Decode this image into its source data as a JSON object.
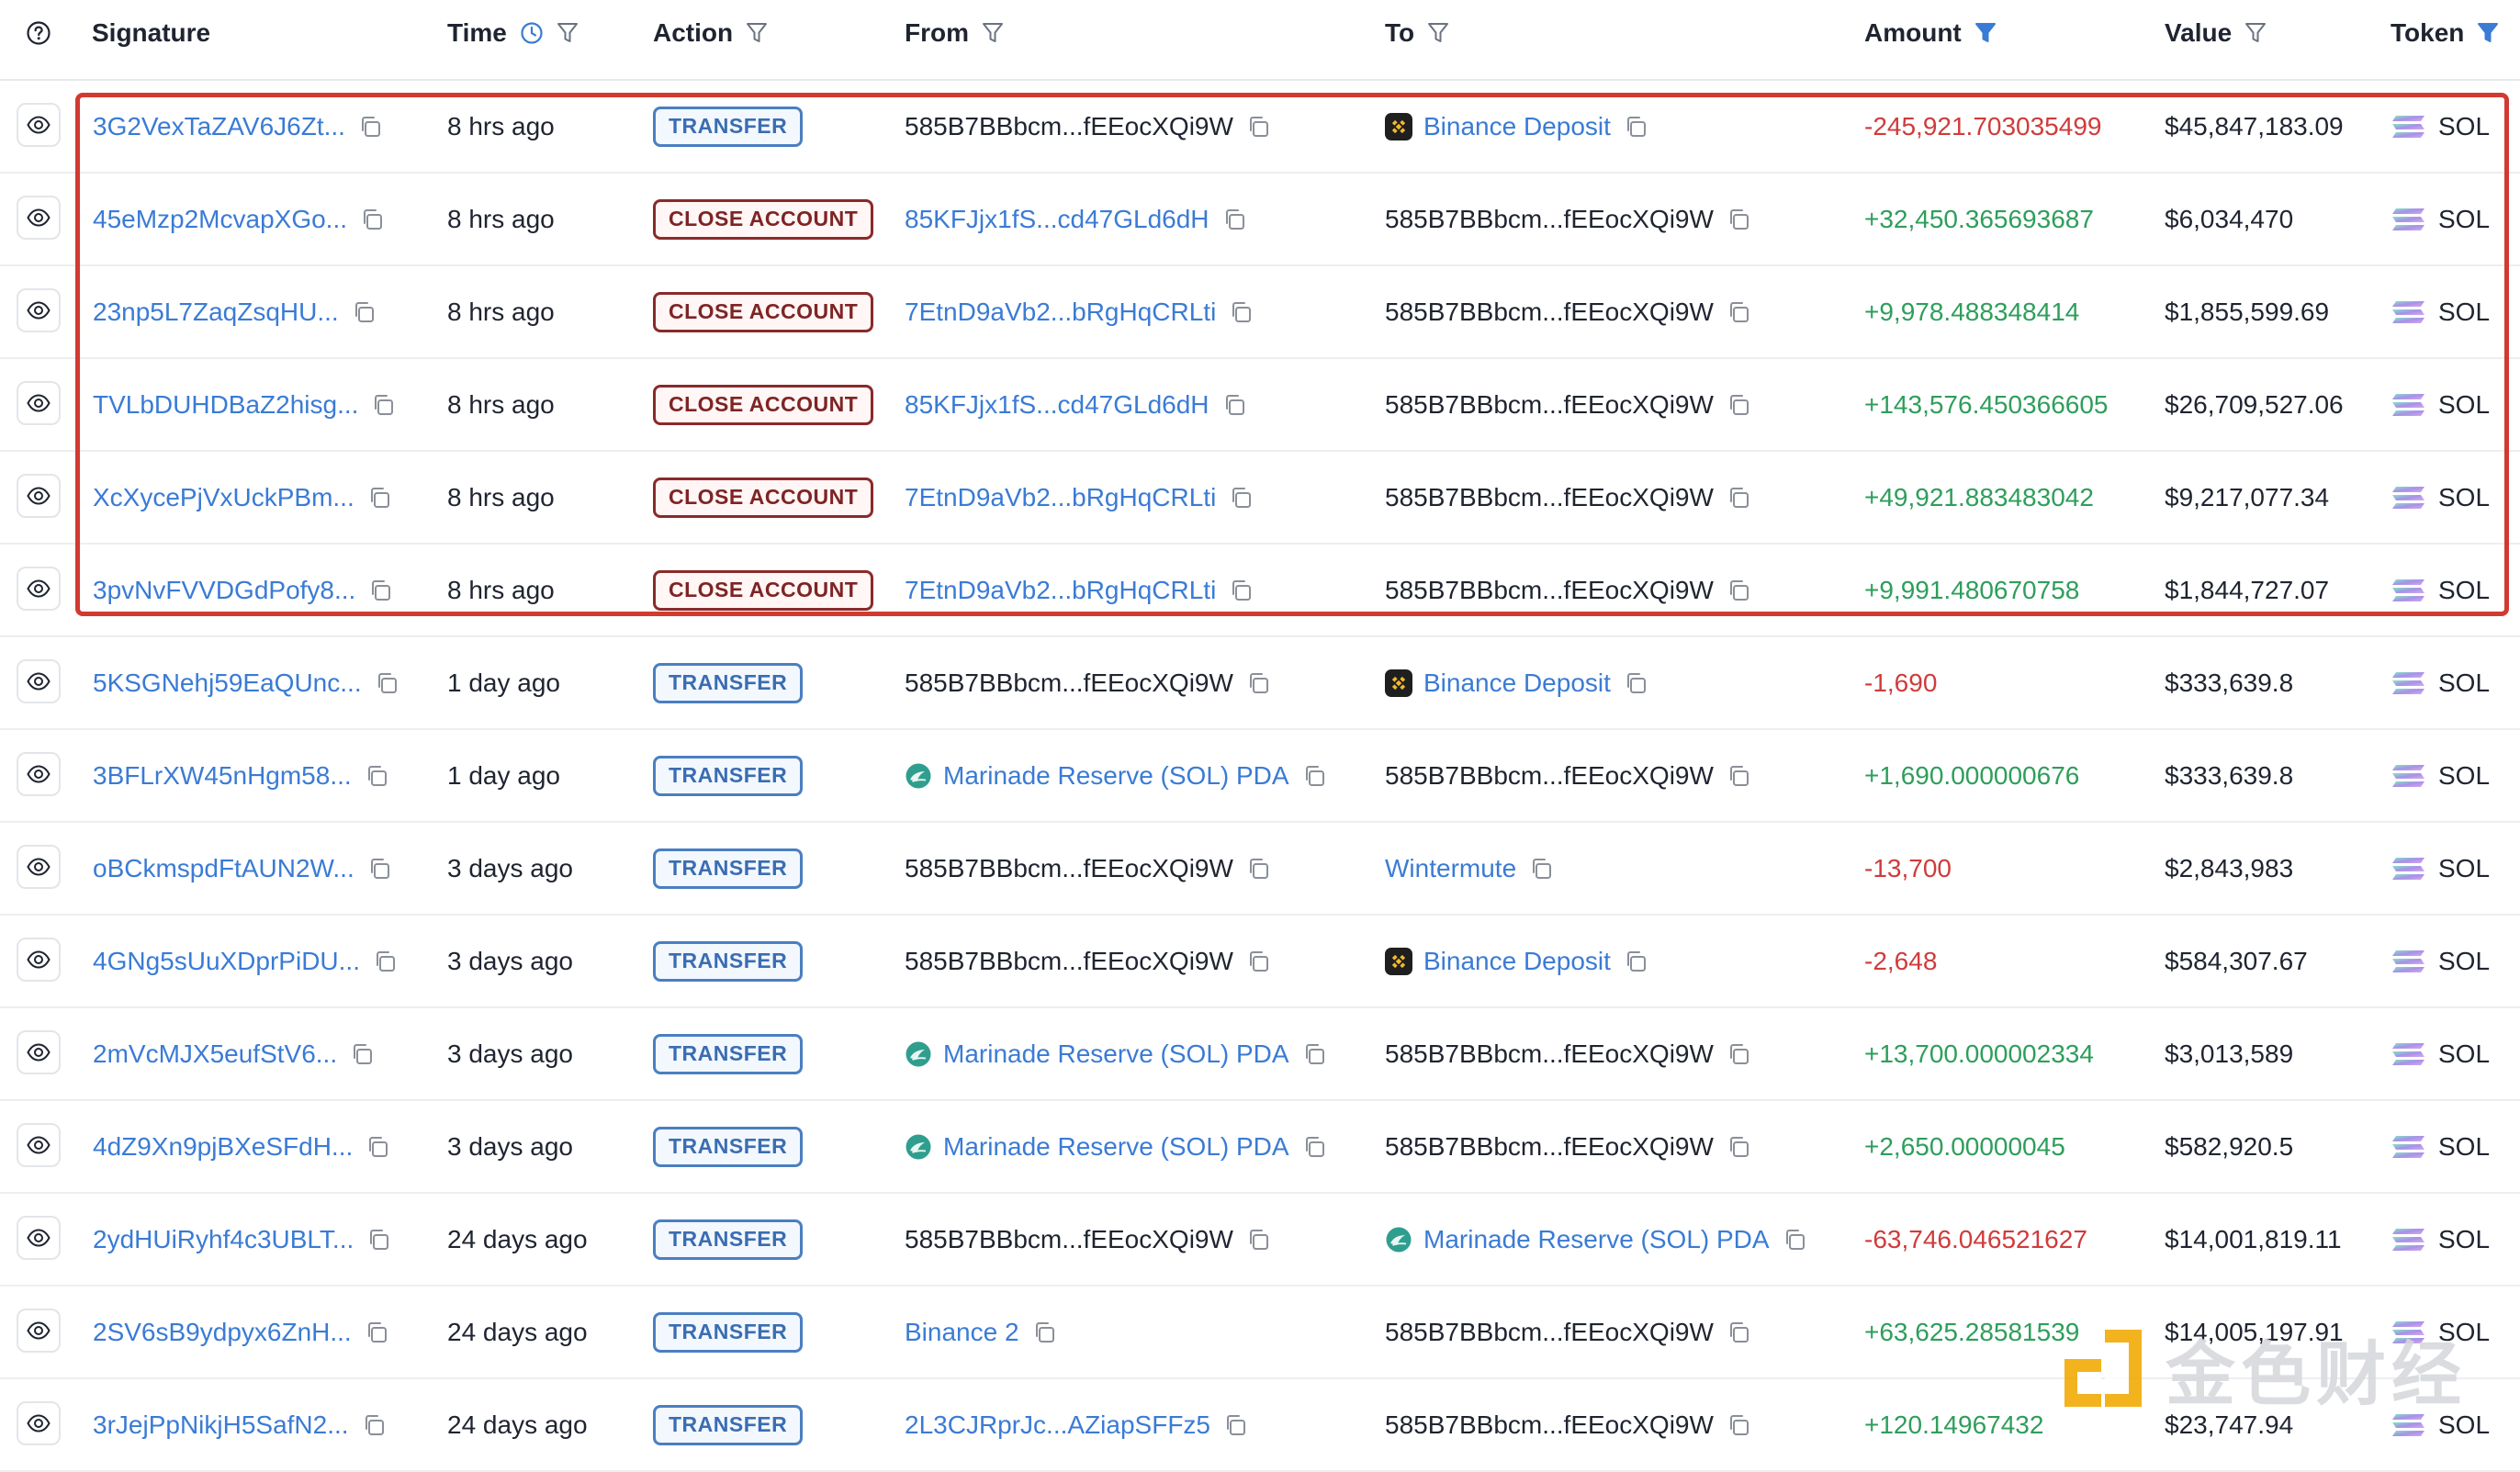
{
  "header": {
    "signature": "Signature",
    "time": "Time",
    "action": "Action",
    "from": "From",
    "to": "To",
    "amount": "Amount",
    "value": "Value",
    "token": "Token"
  },
  "colors": {
    "link": "#3a7bd5",
    "positive": "#2e9e5b",
    "negative": "#d03b3b",
    "highlight": "#d13a30",
    "transfer_badge": "#4a7fc1",
    "close_badge": "#8a2a2a"
  },
  "rows": [
    {
      "sig": "3G2VexTaZAV6J6Zt...",
      "time": "8 hrs ago",
      "action": "TRANSFER",
      "action_type": "transfer",
      "from": {
        "text": "585B7BBbcm...fEEocXQi9W",
        "link": false,
        "icon": ""
      },
      "to": {
        "text": "Binance Deposit",
        "link": true,
        "icon": "binance-icon"
      },
      "amount": "-245,921.703035499",
      "sign": "neg",
      "value": "$45,847,183.09",
      "token": "SOL"
    },
    {
      "sig": "45eMzp2McvapXGo...",
      "time": "8 hrs ago",
      "action": "CLOSE ACCOUNT",
      "action_type": "close",
      "from": {
        "text": "85KFJjx1fS...cd47GLd6dH",
        "link": true,
        "icon": ""
      },
      "to": {
        "text": "585B7BBbcm...fEEocXQi9W",
        "link": false,
        "icon": ""
      },
      "amount": "+32,450.365693687",
      "sign": "pos",
      "value": "$6,034,470",
      "token": "SOL"
    },
    {
      "sig": "23np5L7ZaqZsqHU...",
      "time": "8 hrs ago",
      "action": "CLOSE ACCOUNT",
      "action_type": "close",
      "from": {
        "text": "7EtnD9aVb2...bRgHqCRLti",
        "link": true,
        "icon": ""
      },
      "to": {
        "text": "585B7BBbcm...fEEocXQi9W",
        "link": false,
        "icon": ""
      },
      "amount": "+9,978.488348414",
      "sign": "pos",
      "value": "$1,855,599.69",
      "token": "SOL"
    },
    {
      "sig": "TVLbDUHDBaZ2hisg...",
      "time": "8 hrs ago",
      "action": "CLOSE ACCOUNT",
      "action_type": "close",
      "from": {
        "text": "85KFJjx1fS...cd47GLd6dH",
        "link": true,
        "icon": ""
      },
      "to": {
        "text": "585B7BBbcm...fEEocXQi9W",
        "link": false,
        "icon": ""
      },
      "amount": "+143,576.450366605",
      "sign": "pos",
      "value": "$26,709,527.06",
      "token": "SOL"
    },
    {
      "sig": "XcXycePjVxUckPBm...",
      "time": "8 hrs ago",
      "action": "CLOSE ACCOUNT",
      "action_type": "close",
      "from": {
        "text": "7EtnD9aVb2...bRgHqCRLti",
        "link": true,
        "icon": ""
      },
      "to": {
        "text": "585B7BBbcm...fEEocXQi9W",
        "link": false,
        "icon": ""
      },
      "amount": "+49,921.883483042",
      "sign": "pos",
      "value": "$9,217,077.34",
      "token": "SOL"
    },
    {
      "sig": "3pvNvFVVDGdPofy8...",
      "time": "8 hrs ago",
      "action": "CLOSE ACCOUNT",
      "action_type": "close",
      "from": {
        "text": "7EtnD9aVb2...bRgHqCRLti",
        "link": true,
        "icon": ""
      },
      "to": {
        "text": "585B7BBbcm...fEEocXQi9W",
        "link": false,
        "icon": ""
      },
      "amount": "+9,991.480670758",
      "sign": "pos",
      "value": "$1,844,727.07",
      "token": "SOL"
    },
    {
      "sig": "5KSGNehj59EaQUnc...",
      "time": "1 day ago",
      "action": "TRANSFER",
      "action_type": "transfer",
      "from": {
        "text": "585B7BBbcm...fEEocXQi9W",
        "link": false,
        "icon": ""
      },
      "to": {
        "text": "Binance Deposit",
        "link": true,
        "icon": "binance-icon"
      },
      "amount": "-1,690",
      "sign": "neg",
      "value": "$333,639.8",
      "token": "SOL"
    },
    {
      "sig": "3BFLrXW45nHgm58...",
      "time": "1 day ago",
      "action": "TRANSFER",
      "action_type": "transfer",
      "from": {
        "text": "Marinade Reserve (SOL) PDA",
        "link": true,
        "icon": "marinade-icon"
      },
      "to": {
        "text": "585B7BBbcm...fEEocXQi9W",
        "link": false,
        "icon": ""
      },
      "amount": "+1,690.000000676",
      "sign": "pos",
      "value": "$333,639.8",
      "token": "SOL"
    },
    {
      "sig": "oBCkmspdFtAUN2W...",
      "time": "3 days ago",
      "action": "TRANSFER",
      "action_type": "transfer",
      "from": {
        "text": "585B7BBbcm...fEEocXQi9W",
        "link": false,
        "icon": ""
      },
      "to": {
        "text": "Wintermute",
        "link": true,
        "icon": ""
      },
      "amount": "-13,700",
      "sign": "neg",
      "value": "$2,843,983",
      "token": "SOL"
    },
    {
      "sig": "4GNg5sUuXDprPiDU...",
      "time": "3 days ago",
      "action": "TRANSFER",
      "action_type": "transfer",
      "from": {
        "text": "585B7BBbcm...fEEocXQi9W",
        "link": false,
        "icon": ""
      },
      "to": {
        "text": "Binance Deposit",
        "link": true,
        "icon": "binance-icon"
      },
      "amount": "-2,648",
      "sign": "neg",
      "value": "$584,307.67",
      "token": "SOL"
    },
    {
      "sig": "2mVcMJX5eufStV6...",
      "time": "3 days ago",
      "action": "TRANSFER",
      "action_type": "transfer",
      "from": {
        "text": "Marinade Reserve (SOL) PDA",
        "link": true,
        "icon": "marinade-icon"
      },
      "to": {
        "text": "585B7BBbcm...fEEocXQi9W",
        "link": false,
        "icon": ""
      },
      "amount": "+13,700.000002334",
      "sign": "pos",
      "value": "$3,013,589",
      "token": "SOL"
    },
    {
      "sig": "4dZ9Xn9pjBXeSFdH...",
      "time": "3 days ago",
      "action": "TRANSFER",
      "action_type": "transfer",
      "from": {
        "text": "Marinade Reserve (SOL) PDA",
        "link": true,
        "icon": "marinade-icon"
      },
      "to": {
        "text": "585B7BBbcm...fEEocXQi9W",
        "link": false,
        "icon": ""
      },
      "amount": "+2,650.00000045",
      "sign": "pos",
      "value": "$582,920.5",
      "token": "SOL"
    },
    {
      "sig": "2ydHUiRyhf4c3UBLT...",
      "time": "24 days ago",
      "action": "TRANSFER",
      "action_type": "transfer",
      "from": {
        "text": "585B7BBbcm...fEEocXQi9W",
        "link": false,
        "icon": ""
      },
      "to": {
        "text": "Marinade Reserve (SOL) PDA",
        "link": true,
        "icon": "marinade-icon"
      },
      "amount": "-63,746.046521627",
      "sign": "neg",
      "value": "$14,001,819.11",
      "token": "SOL"
    },
    {
      "sig": "2SV6sB9ydpyx6ZnH...",
      "time": "24 days ago",
      "action": "TRANSFER",
      "action_type": "transfer",
      "from": {
        "text": "Binance 2",
        "link": true,
        "icon": ""
      },
      "to": {
        "text": "585B7BBbcm...fEEocXQi9W",
        "link": false,
        "icon": ""
      },
      "amount": "+63,625.28581539",
      "sign": "pos",
      "value": "$14,005,197.91",
      "token": "SOL"
    },
    {
      "sig": "3rJejPpNikjH5SafN2...",
      "time": "24 days ago",
      "action": "TRANSFER",
      "action_type": "transfer",
      "from": {
        "text": "2L3CJRprJc...AZiapSFFz5",
        "link": true,
        "icon": ""
      },
      "to": {
        "text": "585B7BBbcm...fEEocXQi9W",
        "link": false,
        "icon": ""
      },
      "amount": "+120.14967432",
      "sign": "pos",
      "value": "$23,747.94",
      "token": "SOL"
    }
  ],
  "watermark": {
    "text": "金色财经"
  }
}
